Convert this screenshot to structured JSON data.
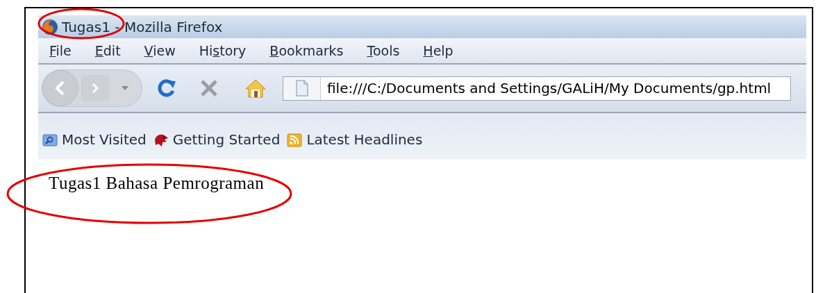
{
  "window": {
    "title": "Tugas1 - Mozilla Firefox"
  },
  "menu": [
    {
      "key": "F",
      "after": "ile"
    },
    {
      "key": "E",
      "after": "dit"
    },
    {
      "key": "V",
      "after": "iew"
    },
    {
      "before": "Hi",
      "key": "s",
      "after": "tory"
    },
    {
      "key": "B",
      "after": "ookmarks"
    },
    {
      "key": "T",
      "after": "ools"
    },
    {
      "key": "H",
      "after": "elp"
    }
  ],
  "address_bar": {
    "value": "file:///C:/Documents and Settings/GALiH/My Documents/gp.html"
  },
  "bookmarks": [
    {
      "label": "Most Visited",
      "kind": "folder"
    },
    {
      "label": "Getting Started",
      "kind": "dragon"
    },
    {
      "label": "Latest Headlines",
      "kind": "feed"
    }
  ],
  "page": {
    "text": "Tugas1 Bahasa Pemrograman"
  }
}
